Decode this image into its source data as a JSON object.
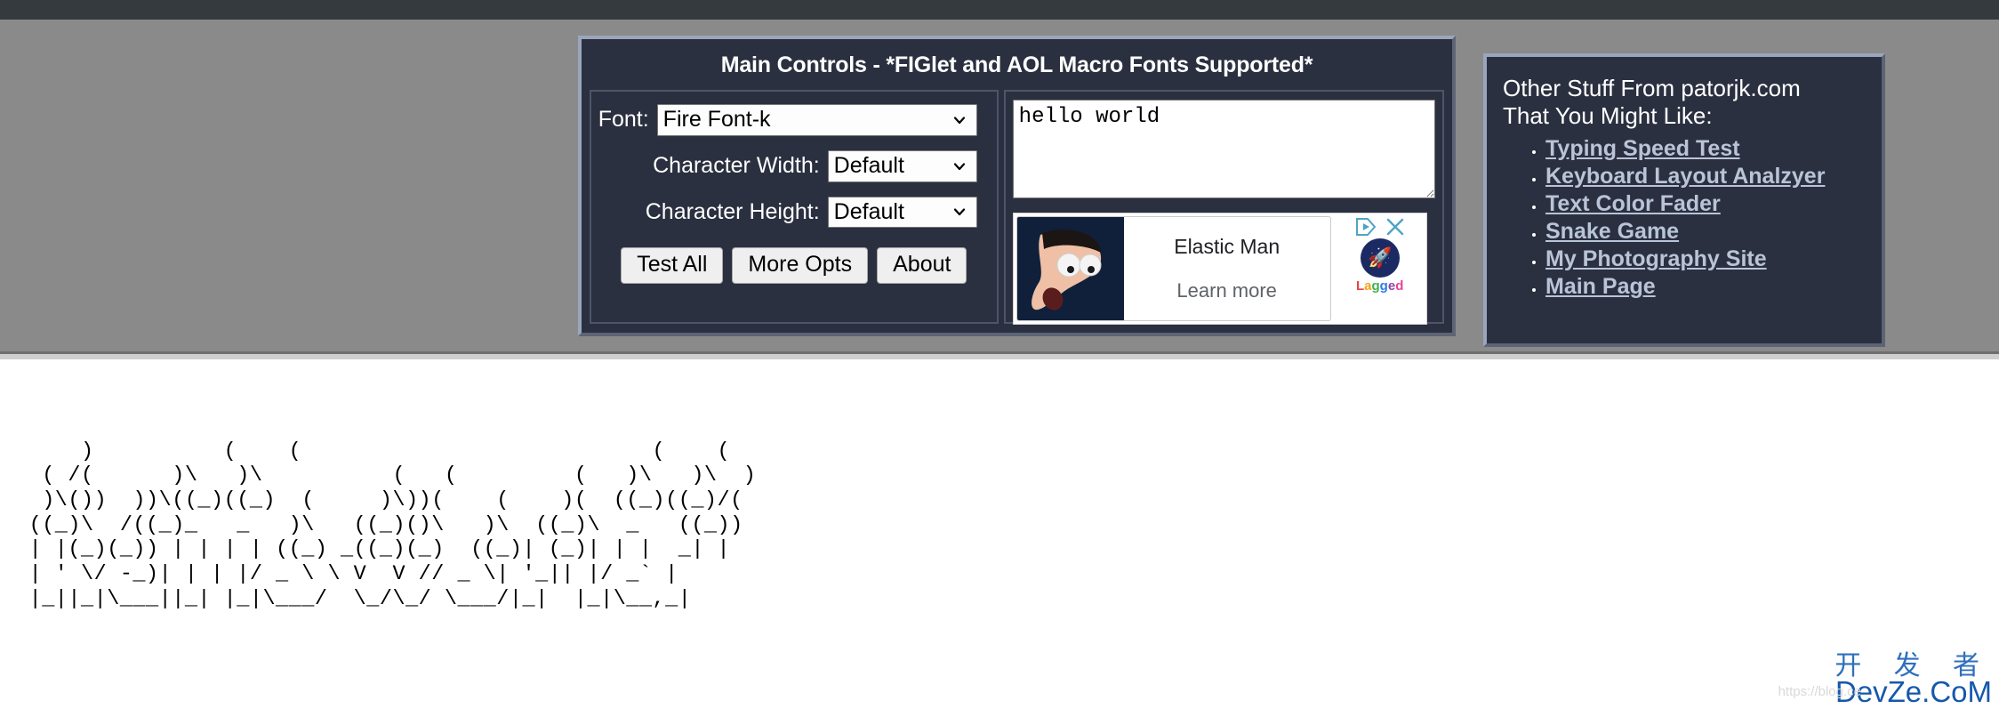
{
  "page": {
    "background_color": "#ffffff",
    "header_band_color": "#8a8a8a",
    "panel_color": "#2b3040"
  },
  "main_panel": {
    "title": "Main Controls - *FIGlet and AOL Macro Fonts Supported*",
    "fields": [
      {
        "label": "Font:",
        "value": "Fire Font-k"
      },
      {
        "label": "Character Width:",
        "value": "Default"
      },
      {
        "label": "Character Height:",
        "value": "Default"
      }
    ],
    "buttons": [
      {
        "label": "Test All"
      },
      {
        "label": "More Opts"
      },
      {
        "label": "About"
      }
    ],
    "text_input": {
      "value": "hello world",
      "placeholder": ""
    }
  },
  "ad": {
    "title": "Elastic Man",
    "cta": "Learn more",
    "advertiser": "Lagged",
    "adchoices_icon": "adchoices-icon",
    "close_icon": "close-icon"
  },
  "sidebar": {
    "heading": "Other Stuff From patorjk.com\nThat You Might Like:",
    "links": [
      {
        "label": "Typing Speed Test"
      },
      {
        "label": "Keyboard Layout Analzyer"
      },
      {
        "label": "Text Color Fader"
      },
      {
        "label": "Snake Game"
      },
      {
        "label": "My Photography Site"
      },
      {
        "label": "Main Page"
      }
    ]
  },
  "output": {
    "ascii_art": "     )          (    (                           (    (\n  ( /(      )\\   )\\          (   (         (   )\\   )\\  )\n  )\\())  ))\\((_)((_)  (     )\\))(    (    )(  ((_)((_)/(\n ((_)\\  /((_)_   _   )\\   ((_)()\\   )\\  ((_)\\  _   ((_))\n | |(_)(_)) | | | | ((_) _((_)(_)  ((_)| (_)| | |  _| |\n | ' \\/ -_)| | | |/ _ \\ \\ V  V // _ \\| '_|| |/ _` |\n |_||_|\\___||_| |_|\\___/  \\_/\\_/ \\___/|_|  |_|\\__,_|"
  },
  "watermark": {
    "chinese": "开 发 者",
    "english": "DevZe.CoM",
    "url": "https://blog.ce"
  }
}
